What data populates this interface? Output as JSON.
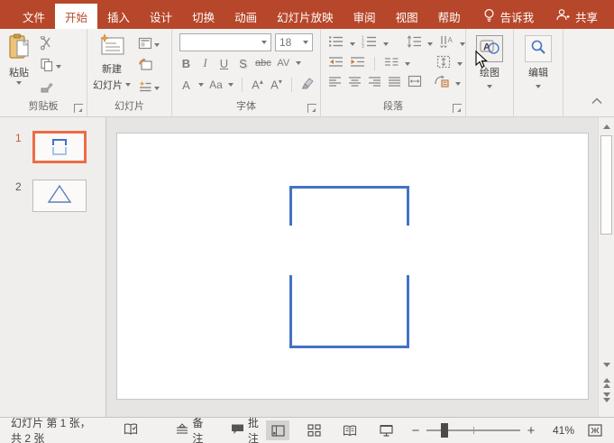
{
  "title_bar": {
    "tabs": [
      {
        "label": "文件"
      },
      {
        "label": "开始"
      },
      {
        "label": "插入"
      },
      {
        "label": "设计"
      },
      {
        "label": "切换"
      },
      {
        "label": "动画"
      },
      {
        "label": "幻灯片放映"
      },
      {
        "label": "审阅"
      },
      {
        "label": "视图"
      },
      {
        "label": "帮助"
      }
    ],
    "tell_me": "告诉我",
    "share": "共享"
  },
  "ribbon": {
    "clipboard": {
      "label": "剪贴板",
      "paste": "粘贴"
    },
    "slides": {
      "label": "幻灯片",
      "new_slide_line1": "新建",
      "new_slide_line2": "幻灯片"
    },
    "font": {
      "label": "字体",
      "size_value": "18",
      "bold": "B",
      "italic": "I",
      "underline": "U",
      "shadow": "S",
      "strike": "abc",
      "spacing": "AV",
      "color": "A",
      "case": "Aa",
      "grow": "A",
      "shrink": "A"
    },
    "paragraph": {
      "label": "段落"
    },
    "drawing": {
      "label": "绘图"
    },
    "editing": {
      "label": "编辑"
    }
  },
  "slide_panel": {
    "slides": [
      {
        "number": "1"
      },
      {
        "number": "2"
      }
    ]
  },
  "status_bar": {
    "slide_info": "幻灯片 第 1 张，共 2 张",
    "notes_label": "备注",
    "comments_label": "批注",
    "zoom_value": "41%"
  },
  "colors": {
    "titlebar_red": "#B7472A",
    "accent_blue": "#4472C4",
    "selection_orange": "#ED6C47",
    "thumb_light_blue": "#A9C2E8"
  }
}
